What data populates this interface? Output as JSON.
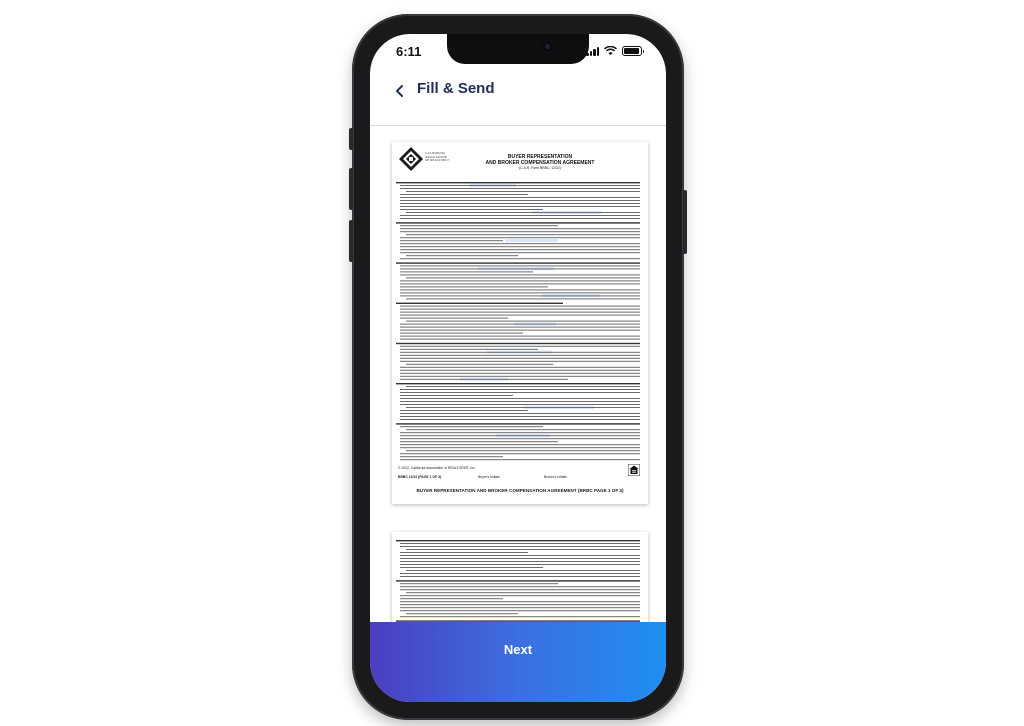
{
  "status_bar": {
    "time": "6:11"
  },
  "header": {
    "title": "Fill & Send"
  },
  "document": {
    "org_lines": [
      "CALIFORNIA",
      "ASSOCIATION",
      "OF REALTORS®"
    ],
    "title_line1": "BUYER REPRESENTATION",
    "title_line2": "AND BROKER COMPENSATION AGREEMENT",
    "form_code": "(C.A.R. Form BRBC, 12/22)",
    "buyer_names": "Sarah Smith and John Smith",
    "broker_name": "Business Escape",
    "location": "Sacramento County",
    "copyright": "© 2022, California Association of REALTORS®, Inc.",
    "form_footer": "BRBC 12/22 (PAGE 1 OF 3)",
    "buyer_initials": "Buyer's Initials",
    "broker_initials": "Broker's Initials",
    "page1_footer": "BUYER REPRESENTATION AND BROKER COMPENSATION AGREEMENT (BRBC PAGE 1 OF 3)"
  },
  "footer": {
    "next_label": "Next"
  },
  "colors": {
    "accent_start": "#4a3fbf",
    "accent_end": "#1f8ff2",
    "title": "#213055"
  },
  "icons": [
    "back-chevron-icon",
    "signal-icon",
    "wifi-icon",
    "battery-icon",
    "car-logo-icon",
    "equal-housing-icon"
  ]
}
